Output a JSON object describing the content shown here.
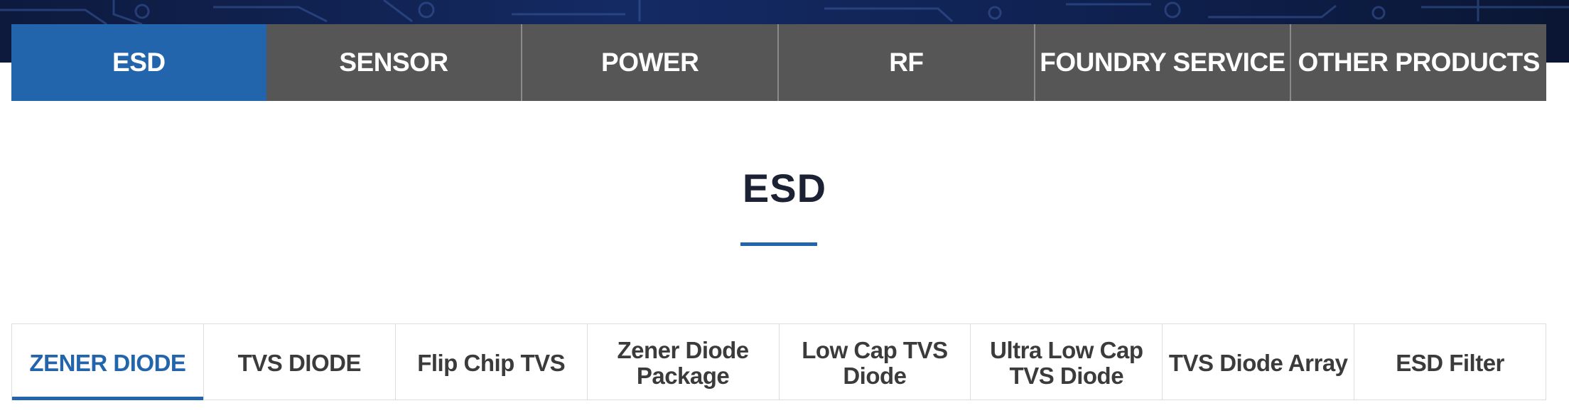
{
  "colors": {
    "accent": "#2265ac",
    "tab_inactive_bg": "#565656",
    "title_text": "#1c2133",
    "subtab_text": "#3b3b3b"
  },
  "main_tabs": [
    {
      "label": "ESD",
      "active": true
    },
    {
      "label": "SENSOR",
      "active": false
    },
    {
      "label": "POWER",
      "active": false
    },
    {
      "label": "RF",
      "active": false
    },
    {
      "label": "FOUNDRY SERVICE",
      "active": false
    },
    {
      "label": "OTHER PRODUCTS",
      "active": false
    }
  ],
  "page": {
    "title": "ESD"
  },
  "sub_tabs": [
    {
      "label": "ZENER DIODE",
      "active": true
    },
    {
      "label": "TVS DIODE",
      "active": false
    },
    {
      "label": "Flip Chip TVS",
      "active": false
    },
    {
      "label": "Zener Diode Package",
      "active": false
    },
    {
      "label": "Low Cap TVS Diode",
      "active": false
    },
    {
      "label": "Ultra Low Cap TVS Diode",
      "active": false
    },
    {
      "label": "TVS Diode Array",
      "active": false
    },
    {
      "label": "ESD Filter",
      "active": false
    }
  ]
}
